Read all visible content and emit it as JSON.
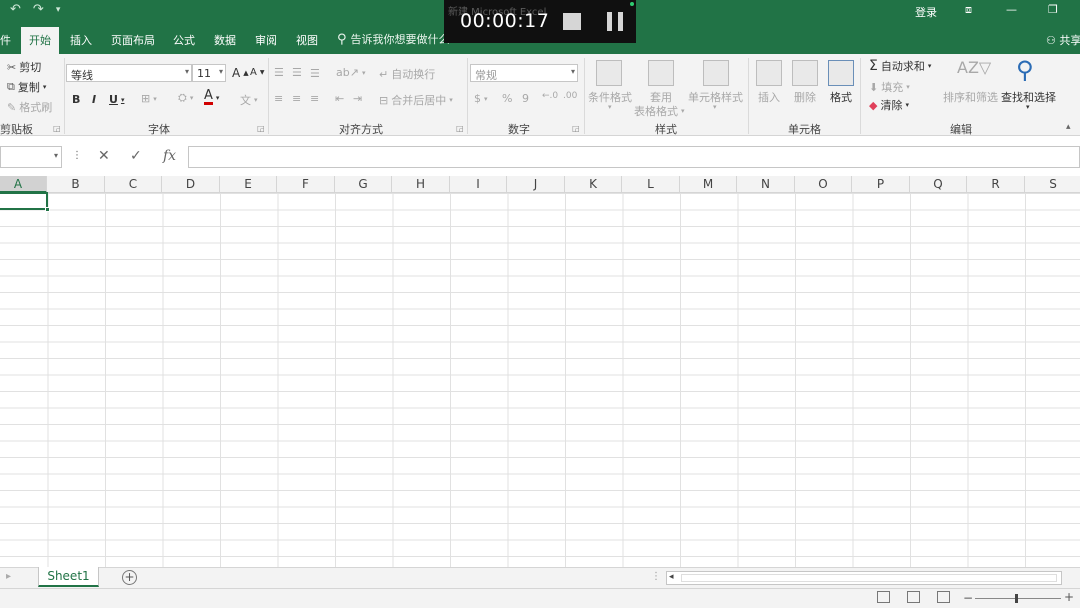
{
  "titlebar": {
    "qat_undo": "↶",
    "qat_redo": "↷",
    "qat_more": "▾",
    "title": "新建 Microsoft Excel",
    "login": "登录",
    "ribbon_display_icon": "⧈",
    "minimize_icon": "—",
    "restore_icon": "❐"
  },
  "recorder": {
    "timer": "00:00:17"
  },
  "tabs": {
    "file": "件",
    "items": [
      "开始",
      "插入",
      "页面布局",
      "公式",
      "数据",
      "审阅",
      "视图"
    ],
    "tell_me_icon": "⚲",
    "tell_me": "告诉我你想要做什么",
    "share": "共享"
  },
  "ribbon": {
    "clipboard": {
      "cut": "剪切",
      "copy": "复制",
      "format_painter": "格式刷",
      "label": "剪贴板"
    },
    "font": {
      "name": "等线",
      "size": "11",
      "grow": "A",
      "shrink": "A",
      "bold": "B",
      "italic": "I",
      "underline": "U",
      "font_color": "A",
      "wen": "文",
      "label": "字体"
    },
    "alignment": {
      "wrap_text": "自动换行",
      "merge_center": "合并后居中",
      "label": "对齐方式"
    },
    "number": {
      "format": "常规",
      "currency": "$",
      "percent": "%",
      "comma": "9",
      "label": "数字"
    },
    "styles": {
      "conditional": "条件格式",
      "as_table_1": "套用",
      "as_table_2": "表格格式",
      "cell_styles": "单元格样式",
      "label": "样式"
    },
    "cells": {
      "insert": "插入",
      "delete": "删除",
      "format": "格式",
      "label": "单元格"
    },
    "editing": {
      "autosum_icon": "Σ",
      "autosum": "自动求和",
      "fill": "填充",
      "clear": "清除",
      "sort_filter": "排序和筛选",
      "find_select": "查找和选择",
      "label": "编辑"
    }
  },
  "formulabar": {
    "cancel": "✕",
    "enter": "✓",
    "fx": "fx",
    "value": ""
  },
  "columns": [
    "A",
    "B",
    "C",
    "D",
    "E",
    "F",
    "G",
    "H",
    "I",
    "J",
    "K",
    "L",
    "M",
    "N",
    "O",
    "P",
    "Q",
    "R",
    "S"
  ],
  "selected_column": "A",
  "sheets": {
    "active": "Sheet1",
    "add": "+"
  },
  "colors": {
    "excel_green": "#217346",
    "ribbon_bg": "#f3f3f3",
    "gridline": "#e1e1e1",
    "font_color_underline": "#d00000"
  }
}
